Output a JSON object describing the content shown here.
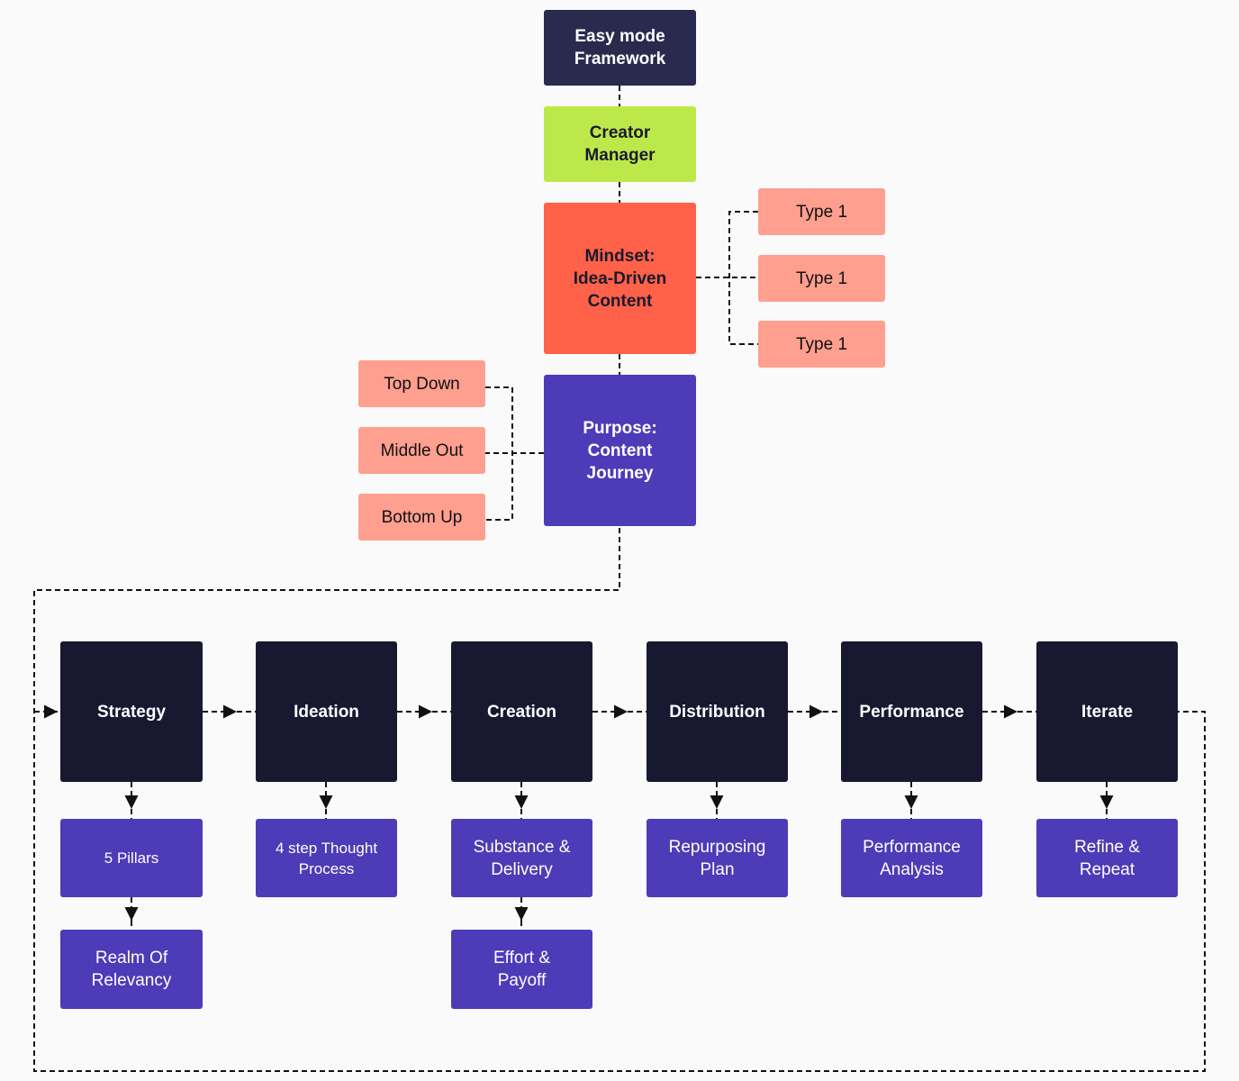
{
  "colors": {
    "background": "#fafafa",
    "framework": "#2a2a4e",
    "creator_manager": "#bde84a",
    "mindset": "#ff6149",
    "purpose": "#4e3bb8",
    "option": "#ff9f90",
    "stage": "#181830",
    "substep": "#4e3bb8",
    "connector": "#111111"
  },
  "top": {
    "framework": "Easy mode\nFramework",
    "creator_manager": "Creator\nManager",
    "mindset": "Mindset:\nIdea-Driven\nContent",
    "purpose": "Purpose:\nContent\nJourney"
  },
  "mindset_types": [
    "Type 1",
    "Type 1",
    "Type 1"
  ],
  "purpose_options": [
    "Top Down",
    "Middle Out",
    "Bottom Up"
  ],
  "stages": [
    {
      "label": "Strategy",
      "substeps": [
        "5 Pillars",
        "Realm Of\nRelevancy"
      ]
    },
    {
      "label": "Ideation",
      "substeps": [
        "4 step Thought\nProcess"
      ]
    },
    {
      "label": "Creation",
      "substeps": [
        "Substance &\nDelivery",
        "Effort &\nPayoff"
      ]
    },
    {
      "label": "Distribution",
      "substeps": [
        "Repurposing\nPlan"
      ]
    },
    {
      "label": "Performance",
      "substeps": [
        "Performance\nAnalysis"
      ]
    },
    {
      "label": "Iterate",
      "substeps": [
        "Refine &\nRepeat"
      ]
    }
  ]
}
